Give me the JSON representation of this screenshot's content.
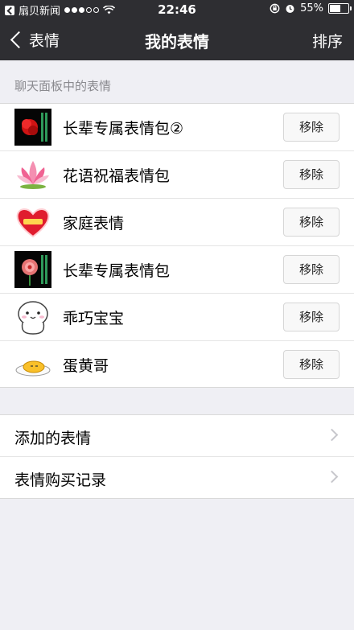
{
  "status_bar": {
    "carrier": "扇贝新闻",
    "time": "22:46",
    "battery": "55%",
    "battery_level": 0.55,
    "signal_dots": 5,
    "signal_filled": 3
  },
  "nav": {
    "back_label": "表情",
    "title": "我的表情",
    "action_label": "排序"
  },
  "section": {
    "label": "聊天面板中的表情"
  },
  "sticker_packs": [
    {
      "name": "长辈专属表情包②",
      "remove_label": "移除",
      "icon": "red-flower-sticker-icon"
    },
    {
      "name": "花语祝福表情包",
      "remove_label": "移除",
      "icon": "lotus-sticker-icon"
    },
    {
      "name": "家庭表情",
      "remove_label": "移除",
      "icon": "red-heart-sticker-icon"
    },
    {
      "name": "长辈专属表情包",
      "remove_label": "移除",
      "icon": "pink-rose-sticker-icon"
    },
    {
      "name": "乖巧宝宝",
      "remove_label": "移除",
      "icon": "cute-baby-sticker-icon"
    },
    {
      "name": "蛋黄哥",
      "remove_label": "移除",
      "icon": "egg-yolk-sticker-icon"
    }
  ],
  "links": [
    {
      "label": "添加的表情"
    },
    {
      "label": "表情购买记录"
    }
  ],
  "colors": {
    "nav_background": "#2e2e32",
    "page_background": "#efeff4",
    "section_label": "#8a8a8f"
  }
}
